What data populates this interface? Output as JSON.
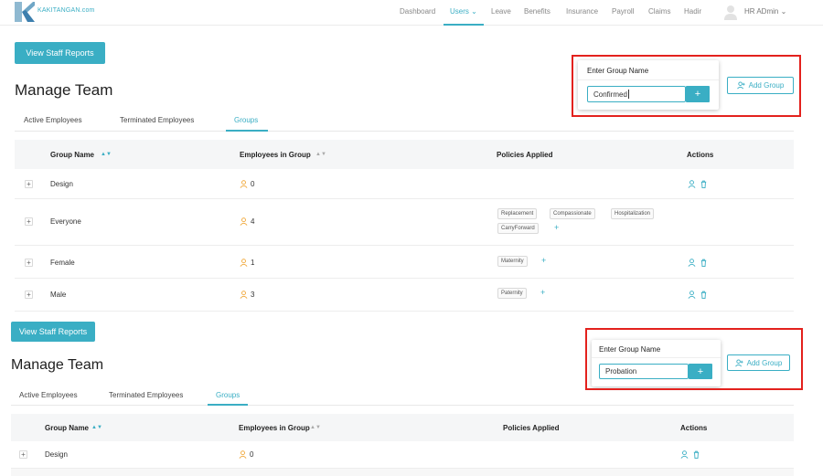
{
  "app": {
    "logo_text": "KAKITANGAN.com",
    "brand_color": "#3aaec4",
    "highlight_color": "#e3211d"
  },
  "nav": {
    "items": [
      "Dashboard",
      "Users",
      "Leave",
      "Benefits",
      "Insurance",
      "Payroll",
      "Claims",
      "Hadir"
    ],
    "active": "Users",
    "user_name": "HR ADmin"
  },
  "top": {
    "staff_reports_label": "View Staff Reports",
    "title": "Manage Team",
    "tabs": [
      "Active Employees",
      "Terminated Employees",
      "Groups"
    ],
    "active_tab": "Groups",
    "popover": {
      "title": "Enter Group Name",
      "input_value": "Confirmed",
      "add_symbol": "+"
    },
    "add_group_label": "Add Group",
    "columns": [
      "Group Name",
      "Employees in Group",
      "Policies Applied",
      "Actions"
    ],
    "rows": [
      {
        "name": "Design",
        "employees": "0",
        "policies": []
      },
      {
        "name": "Everyone",
        "employees": "4",
        "policies": [
          "Replacement",
          "Compassionate",
          "Hospitalization",
          "CarryForward"
        ]
      },
      {
        "name": "Female",
        "employees": "1",
        "policies": [
          "Maternity"
        ]
      },
      {
        "name": "Male",
        "employees": "3",
        "policies": [
          "Paternity"
        ]
      }
    ]
  },
  "bottom": {
    "staff_reports_label": "View Staff Reports",
    "title": "Manage Team",
    "tabs": [
      "Active Employees",
      "Terminated Employees",
      "Groups"
    ],
    "active_tab": "Groups",
    "popover": {
      "title": "Enter Group Name",
      "input_value": "Probation",
      "add_symbol": "+"
    },
    "add_group_label": "Add Group",
    "columns": [
      "Group Name",
      "Employees in Group",
      "Policies Applied",
      "Actions"
    ],
    "rows": [
      {
        "name": "Design",
        "employees": "0",
        "policies": []
      }
    ]
  }
}
